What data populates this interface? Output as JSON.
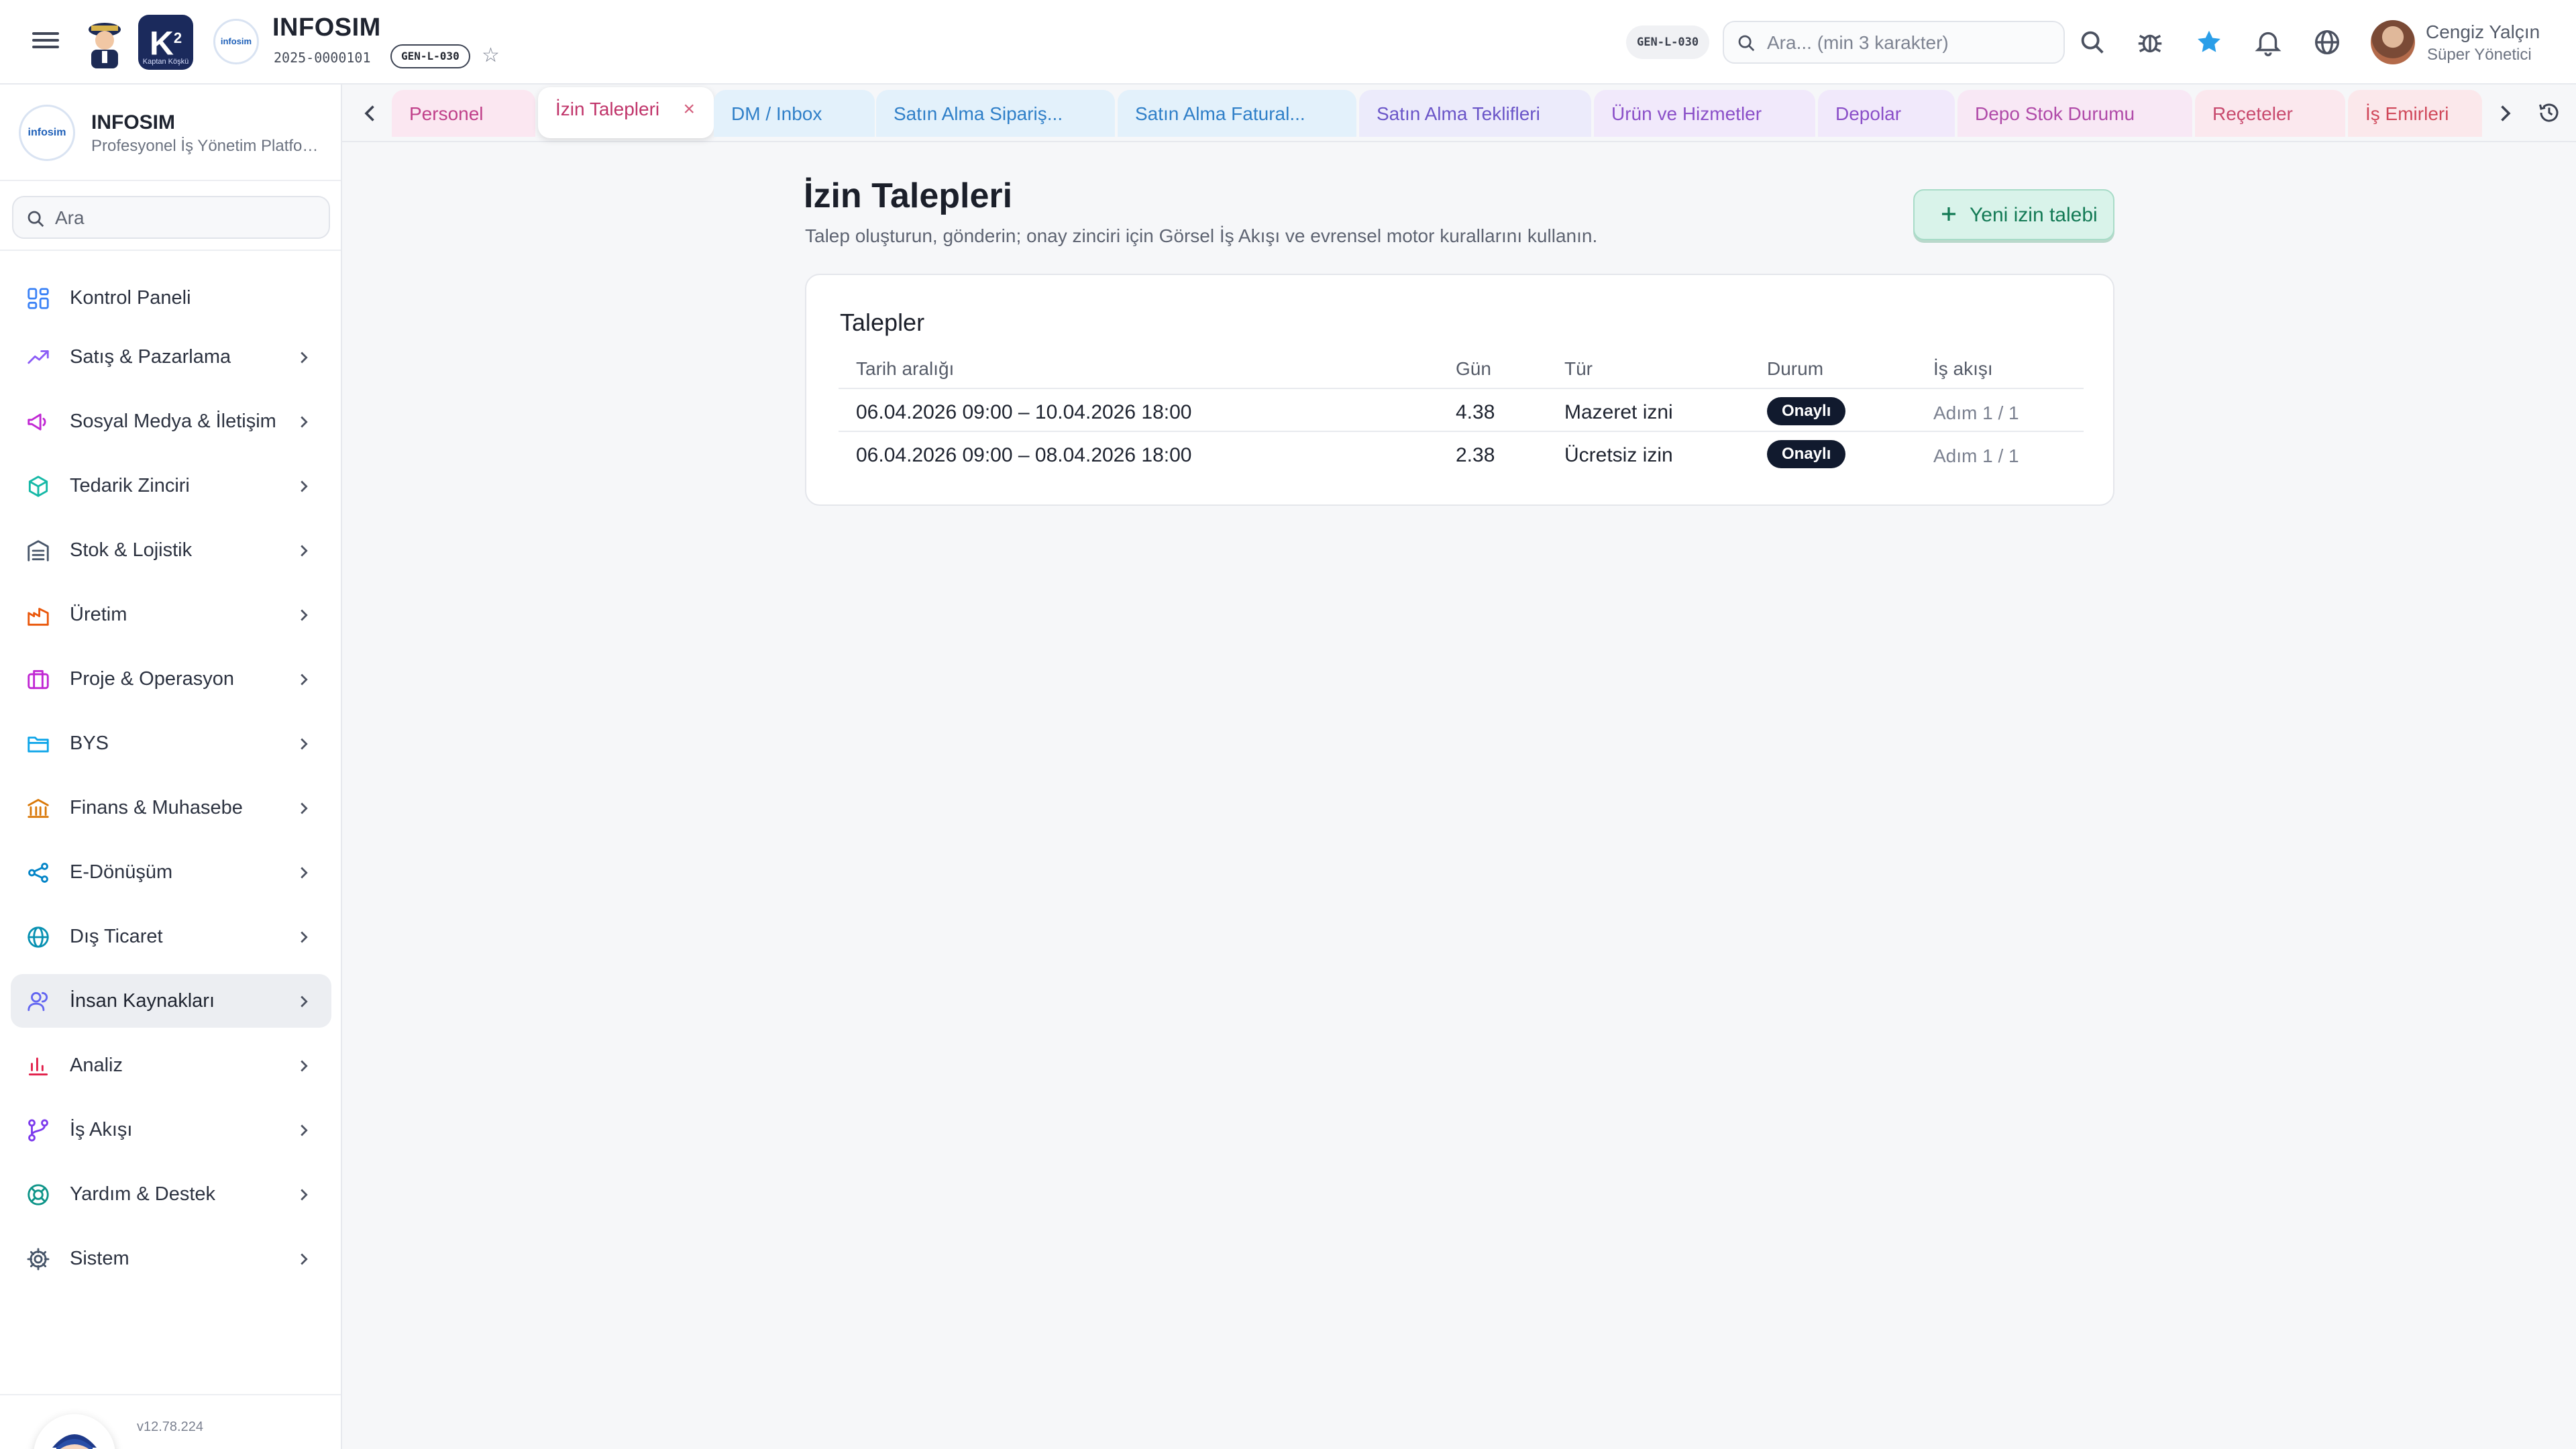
{
  "header": {
    "brand_title": "INFOSIM",
    "brand_code": "2025-0000101",
    "env_chip": "GEN-L-030",
    "env_chip_right": "GEN-L-030",
    "k2_small": "Kaptan Köşkü",
    "badge_text": "infosim",
    "search_placeholder": "Ara... (min 3 karakter)",
    "user_name": "Cengiz Yalçın",
    "user_role": "Süper Yönetici",
    "icons": [
      "menu-icon",
      "search-icon",
      "bug-icon",
      "star-icon",
      "bell-icon",
      "globe-icon"
    ],
    "accent_star_color": "#2a9ee8"
  },
  "sidebar": {
    "title": "INFOSIM",
    "subtitle": "Profesyonel İş Yönetim Platformu",
    "logo_text": "infosim",
    "search_placeholder": "Ara",
    "items": [
      {
        "label": "Kontrol Paneli",
        "icon": "dashboard-icon",
        "color": "#3b82f6"
      },
      {
        "label": "Satış & Pazarlama",
        "icon": "trend-icon",
        "color": "#8b5cf6"
      },
      {
        "label": "Sosyal Medya & İletişim",
        "icon": "megaphone-icon",
        "color": "#c026d3"
      },
      {
        "label": "Tedarik Zinciri",
        "icon": "box-icon",
        "color": "#14b8a6"
      },
      {
        "label": "Stok & Lojistik",
        "icon": "warehouse-icon",
        "color": "#475569"
      },
      {
        "label": "Üretim",
        "icon": "factory-icon",
        "color": "#ea580c"
      },
      {
        "label": "Proje & Operasyon",
        "icon": "briefcase-icon",
        "color": "#c026d3"
      },
      {
        "label": "BYS",
        "icon": "folder-icon",
        "color": "#0ea5e9"
      },
      {
        "label": "Finans & Muhasebe",
        "icon": "bank-icon",
        "color": "#d97706"
      },
      {
        "label": "E-Dönüşüm",
        "icon": "share-icon",
        "color": "#0284c7"
      },
      {
        "label": "Dış Ticaret",
        "icon": "globe-icon",
        "color": "#0891b2"
      },
      {
        "label": "İnsan Kaynakları",
        "icon": "users-icon",
        "color": "#6366f1"
      },
      {
        "label": "Analiz",
        "icon": "bar-chart-icon",
        "color": "#e11d48"
      },
      {
        "label": "İş Akışı",
        "icon": "workflow-icon",
        "color": "#7c3aed"
      },
      {
        "label": "Yardım & Destek",
        "icon": "lifebuoy-icon",
        "color": "#0d9488"
      },
      {
        "label": "Sistem",
        "icon": "gear-icon",
        "color": "#475569"
      }
    ],
    "active_index": 11,
    "version": "v12.78.224"
  },
  "tabs": [
    {
      "label": "Personel",
      "color": "#c0408a",
      "bg": "#fbe7f1"
    },
    {
      "label": "İzin Talepleri",
      "color": "#c0346a",
      "bg": "#ffffff",
      "active": true
    },
    {
      "label": "DM / Inbox",
      "color": "#2f7fc8",
      "bg": "#e3f1fb"
    },
    {
      "label": "Satın Alma Sipariş...",
      "color": "#2f7fc8",
      "bg": "#e3f1fb"
    },
    {
      "label": "Satın Alma Fatural...",
      "color": "#2f7fc8",
      "bg": "#e3f1fb"
    },
    {
      "label": "Satın Alma Teklifleri",
      "color": "#6a55c8",
      "bg": "#ecebfb"
    },
    {
      "label": "Ürün ve Hizmetler",
      "color": "#8a4fc8",
      "bg": "#f1e9fb"
    },
    {
      "label": "Depolar",
      "color": "#8a4fc8",
      "bg": "#f1e9fb"
    },
    {
      "label": "Depo Stok Durumu",
      "color": "#b04aa8",
      "bg": "#f8e8f5"
    },
    {
      "label": "Reçeteler",
      "color": "#c84a6e",
      "bg": "#fbe8ee"
    },
    {
      "label": "İş Emirleri",
      "color": "#d0485a",
      "bg": "#fbe8eb"
    }
  ],
  "main": {
    "title": "İzin Talepleri",
    "description": "Talep oluşturun, gönderin; onay zinciri için Görsel İş Akışı ve evrensel motor kurallarını kullanın.",
    "new_button": "Yeni izin talebi",
    "card_title": "Talepler",
    "columns": [
      "Tarih aralığı",
      "Gün",
      "Tür",
      "Durum",
      "İş akışı"
    ],
    "rows": [
      {
        "range": "06.04.2026  09:00 – 10.04.2026  18:00",
        "days": "4.38",
        "type": "Mazeret izni",
        "status": "Onaylı",
        "workflow": "Adım 1 / 1"
      },
      {
        "range": "06.04.2026  09:00 – 08.04.2026  18:00",
        "days": "2.38",
        "type": "Ücretsiz izin",
        "status": "Onaylı",
        "workflow": "Adım 1 / 1"
      }
    ]
  }
}
